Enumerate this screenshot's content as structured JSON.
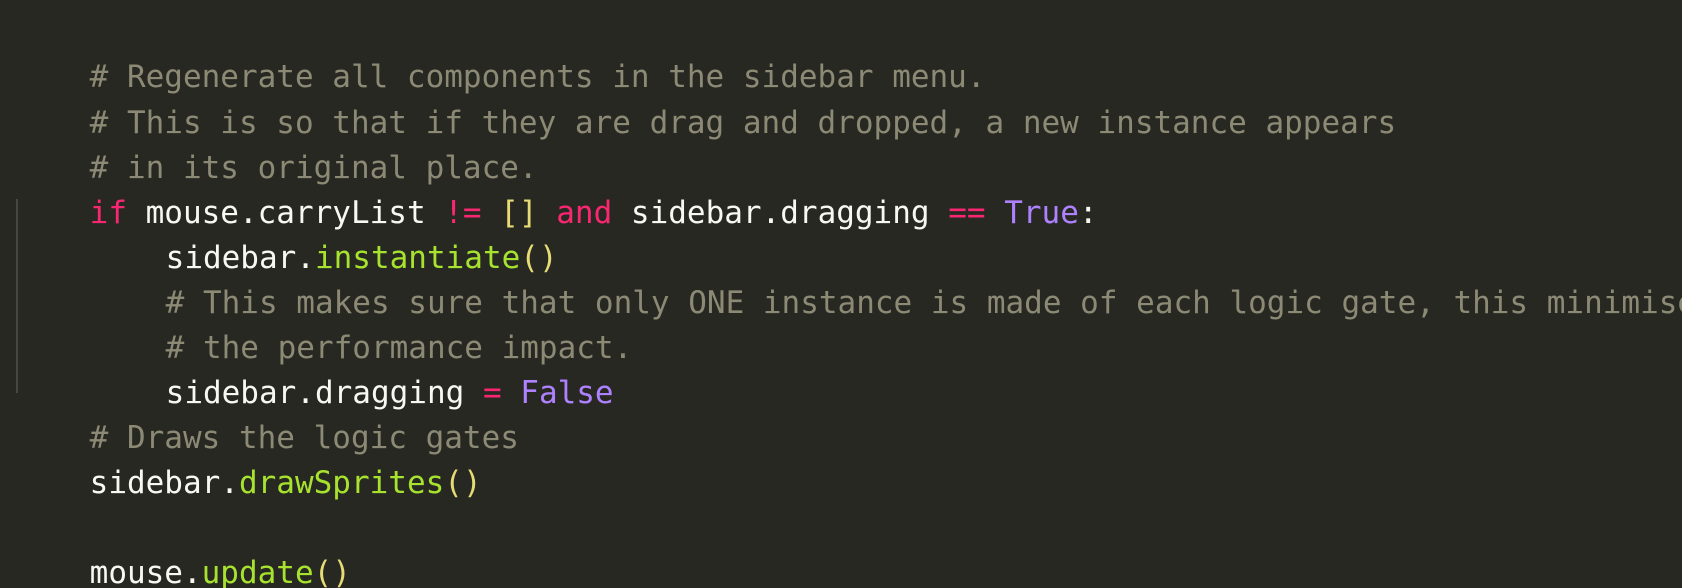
{
  "editor": {
    "lines": [
      {
        "tokens": [
          {
            "text": "# Regenerate all components in the sidebar menu."
          }
        ]
      },
      {
        "tokens": [
          {
            "text": "# This is so that if they are drag and dropped, a new instance appears"
          }
        ]
      },
      {
        "tokens": [
          {
            "text": "# in its original place."
          }
        ]
      },
      {
        "tokens": [
          {
            "text": "if"
          },
          {
            "text": " mouse.carryList "
          },
          {
            "text": "!="
          },
          {
            "text": " "
          },
          {
            "text": "[]"
          },
          {
            "text": " "
          },
          {
            "text": "and"
          },
          {
            "text": " sidebar.dragging "
          },
          {
            "text": "=="
          },
          {
            "text": " "
          },
          {
            "text": "True"
          },
          {
            "text": ":"
          }
        ]
      },
      {
        "tokens": [
          {
            "text": "sidebar."
          },
          {
            "text": "instantiate"
          },
          {
            "text": "()"
          }
        ]
      },
      {
        "tokens": [
          {
            "text": "# This makes sure that only ONE instance is made of each logic gate, this minimises"
          }
        ]
      },
      {
        "tokens": [
          {
            "text": "# the performance impact."
          }
        ]
      },
      {
        "tokens": [
          {
            "text": "sidebar.dragging "
          },
          {
            "text": "="
          },
          {
            "text": " "
          },
          {
            "text": "False"
          }
        ]
      },
      {
        "tokens": [
          {
            "text": "# Draws the logic gates"
          }
        ]
      },
      {
        "tokens": [
          {
            "text": "sidebar."
          },
          {
            "text": "drawSprites"
          },
          {
            "text": "()"
          }
        ]
      },
      {
        "tokens": []
      },
      {
        "tokens": [
          {
            "text": "mouse."
          },
          {
            "text": "update"
          },
          {
            "text": "()"
          }
        ]
      }
    ]
  },
  "theme": {
    "background": "#272822",
    "comment": "#8c8a75",
    "keyword": "#f92672",
    "constant": "#ae81ff",
    "function": "#a6e22e",
    "paren": "#e6db74",
    "text": "#f8f8f2"
  }
}
